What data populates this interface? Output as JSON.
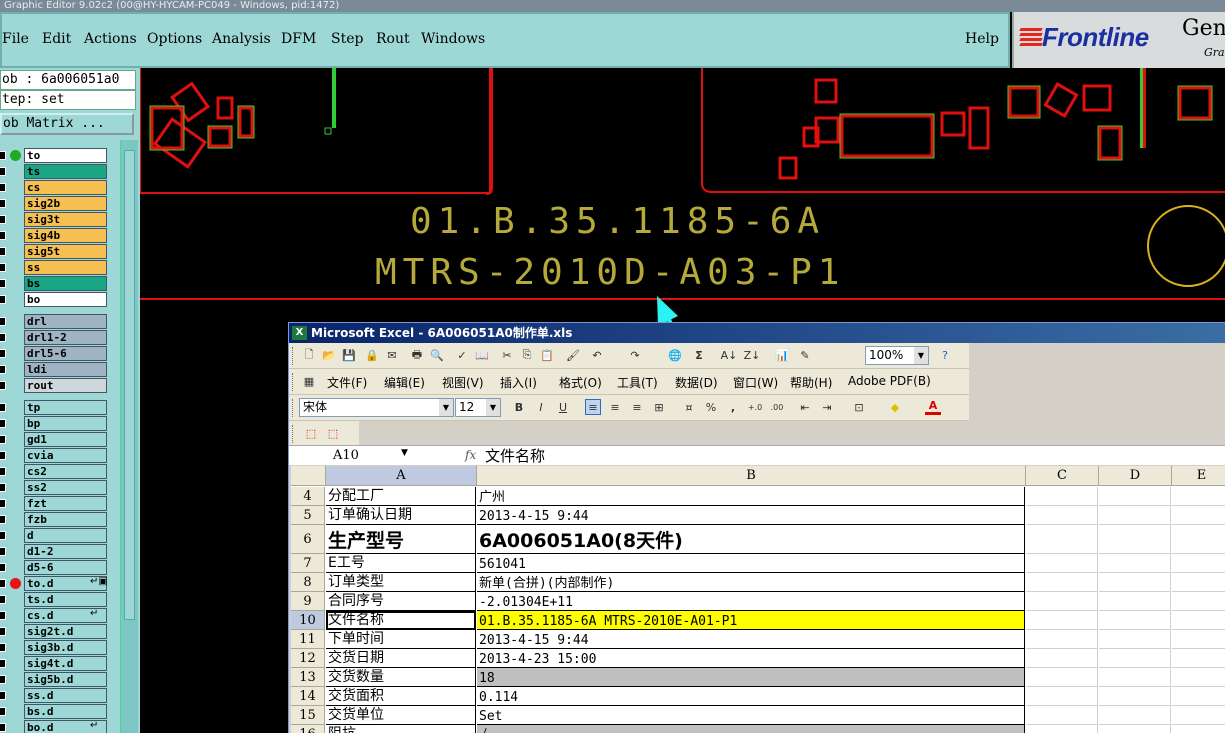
{
  "app": {
    "title": "Graphic Editor 9.02c2 (00@HY-HYCAM-PC049 - Windows, pid:1472)",
    "menu": [
      "File",
      "Edit",
      "Actions",
      "Options",
      "Analysis",
      "DFM",
      "Step",
      "Rout",
      "Windows"
    ],
    "help": "Help",
    "logo": {
      "brand": "Frontline",
      "gen": "Gen",
      "sub": "Gra"
    }
  },
  "left_panel": {
    "job_label": "ob : 6a006051a0",
    "step_label": "tep: set",
    "job_matrix": "ob Matrix ...",
    "layers": [
      {
        "name": "to",
        "color": "#ffffff",
        "dot": "#22aa22"
      },
      {
        "name": "ts",
        "color": "#1aa585"
      },
      {
        "name": "cs",
        "color": "#f5c050"
      },
      {
        "name": "sig2b",
        "color": "#f5c050"
      },
      {
        "name": "sig3t",
        "color": "#f5c050"
      },
      {
        "name": "sig4b",
        "color": "#f5c050"
      },
      {
        "name": "sig5t",
        "color": "#f5c050"
      },
      {
        "name": "ss",
        "color": "#f5c050"
      },
      {
        "name": "bs",
        "color": "#1aa585"
      },
      {
        "name": "bo",
        "color": "#ffffff"
      },
      {
        "name": "drl",
        "color": "#9fb3c2"
      },
      {
        "name": "drl1-2",
        "color": "#9fb3c2"
      },
      {
        "name": "drl5-6",
        "color": "#9fb3c2"
      },
      {
        "name": "ldi",
        "color": "#9fb3c2"
      },
      {
        "name": "rout",
        "color": "#cfd6dc"
      },
      {
        "name": "tp",
        "color": "#9ed8d6"
      },
      {
        "name": "bp",
        "color": "#9ed8d6"
      },
      {
        "name": "gd1",
        "color": "#9ed8d6"
      },
      {
        "name": "cvia",
        "color": "#9ed8d6"
      },
      {
        "name": "cs2",
        "color": "#9ed8d6"
      },
      {
        "name": "ss2",
        "color": "#9ed8d6"
      },
      {
        "name": "fzt",
        "color": "#9ed8d6"
      },
      {
        "name": "fzb",
        "color": "#9ed8d6"
      },
      {
        "name": "d",
        "color": "#9ed8d6"
      },
      {
        "name": "d1-2",
        "color": "#9ed8d6"
      },
      {
        "name": "d5-6",
        "color": "#9ed8d6"
      },
      {
        "name": "to.d",
        "color": "#9ed8d6",
        "dot": "#ee1111",
        "mark": "↵▣"
      },
      {
        "name": "ts.d",
        "color": "#9ed8d6"
      },
      {
        "name": "cs.d",
        "color": "#9ed8d6",
        "mark": "↵"
      },
      {
        "name": "sig2t.d",
        "color": "#9ed8d6"
      },
      {
        "name": "sig3b.d",
        "color": "#9ed8d6"
      },
      {
        "name": "sig4t.d",
        "color": "#9ed8d6"
      },
      {
        "name": "sig5b.d",
        "color": "#9ed8d6"
      },
      {
        "name": "ss.d",
        "color": "#9ed8d6"
      },
      {
        "name": "bs.d",
        "color": "#9ed8d6"
      },
      {
        "name": "bo.d",
        "color": "#9ed8d6",
        "mark": "↵"
      }
    ]
  },
  "canvas": {
    "line1": "01.B.35.1185-6A",
    "line2": "MTRS-2010D-A03-P1"
  },
  "excel": {
    "title": "Microsoft Excel - 6A006051A0制作单.xls",
    "menu": [
      "文件(F)",
      "编辑(E)",
      "视图(V)",
      "插入(I)",
      "格式(O)",
      "工具(T)",
      "数据(D)",
      "窗口(W)",
      "帮助(H)",
      "Adobe PDF(B)"
    ],
    "zoom": "100%",
    "font_name": "宋体",
    "font_size": "12",
    "name_box": "A10",
    "fx": "fx",
    "formula": "文件名称",
    "columns": [
      "A",
      "B",
      "C",
      "D",
      "E"
    ],
    "rows": [
      {
        "n": "4",
        "a": "分配工厂",
        "b": "广州"
      },
      {
        "n": "5",
        "a": "订单确认日期",
        "b": "2013-4-15 9:44"
      },
      {
        "n": "6",
        "a": "生产型号",
        "b": "6A006051A0(8天件)"
      },
      {
        "n": "7",
        "a": "E工号",
        "b": "561041"
      },
      {
        "n": "8",
        "a": "订单类型",
        "b": "新单(合拼)(内部制作)"
      },
      {
        "n": "9",
        "a": "合同序号",
        "b": "-2.01304E+11"
      },
      {
        "n": "10",
        "a": "文件名称",
        "b": "01.B.35.1185-6A MTRS-2010E-A01-P1"
      },
      {
        "n": "11",
        "a": "下单时间",
        "b": "2013-4-15 9:44"
      },
      {
        "n": "12",
        "a": "交货日期",
        "b": "2013-4-23 15:00"
      },
      {
        "n": "13",
        "a": "交货数量",
        "b": "18"
      },
      {
        "n": "14",
        "a": "交货面积",
        "b": "0.114"
      },
      {
        "n": "15",
        "a": "交货单位",
        "b": "Set"
      },
      {
        "n": "16",
        "a": "阻抗",
        "b": "√"
      }
    ]
  }
}
